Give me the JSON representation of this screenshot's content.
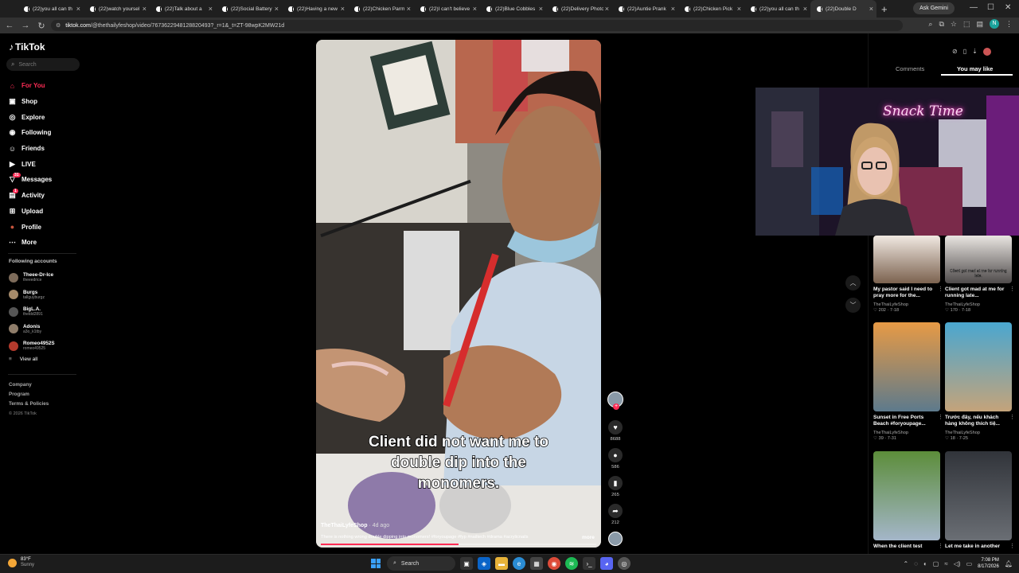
{
  "browser": {
    "tabs": [
      {
        "label": "(22)you all can th"
      },
      {
        "label": "(22)watch yoursel"
      },
      {
        "label": "(22)Talk about a"
      },
      {
        "label": "(22)Social Battery"
      },
      {
        "label": "(22)Having a new"
      },
      {
        "label": "(22)Chicken Parm"
      },
      {
        "label": "(22)I can't believe"
      },
      {
        "label": "(22)Blue Cobbles"
      },
      {
        "label": "(22)Delivery Photo"
      },
      {
        "label": "(22)Auntie Prank"
      },
      {
        "label": "(22)Chicken Pick"
      },
      {
        "label": "(22)you all can th"
      },
      {
        "label": "(22)Double D"
      }
    ],
    "ask_gemini": "Ask Gemini",
    "url_host": "tiktok.com",
    "url_path": "/@thethailyfeshop/video/7673622948128820493?_r=1&_t=ZT-98wpK2MW21d",
    "profile_initial": "N"
  },
  "sidebar": {
    "brand": "TikTok",
    "search_placeholder": "Search",
    "nav": [
      {
        "label": "For You",
        "icon": "home-icon",
        "active": true
      },
      {
        "label": "Shop",
        "icon": "shop-icon"
      },
      {
        "label": "Explore",
        "icon": "compass-icon"
      },
      {
        "label": "Following",
        "icon": "following-icon"
      },
      {
        "label": "Friends",
        "icon": "friends-icon"
      },
      {
        "label": "LIVE",
        "icon": "live-icon"
      },
      {
        "label": "Messages",
        "icon": "messages-icon",
        "badge": "31"
      },
      {
        "label": "Activity",
        "icon": "activity-icon",
        "badge": "1"
      },
      {
        "label": "Upload",
        "icon": "upload-icon"
      },
      {
        "label": "Profile",
        "icon": "profile-icon"
      },
      {
        "label": "More",
        "icon": "more-icon"
      }
    ],
    "following_title": "Following accounts",
    "accounts": [
      {
        "name": "Theee-Dr-Ice",
        "handle": "theeedrice",
        "color": "#7d6b5a"
      },
      {
        "name": "Burgs",
        "handle": "tallguyburgz",
        "color": "#a58a6a"
      },
      {
        "name": "BigL.A.",
        "handle": "theldd2891",
        "color": "#555"
      },
      {
        "name": "Adonis",
        "handle": "a3o_k1tby",
        "color": "#8f7d6a"
      },
      {
        "name": "Romeo4952S",
        "handle": "romeo49525",
        "color": "#b33a2c"
      }
    ],
    "view_all": "View all",
    "footer": [
      "Company",
      "Program",
      "Terms & Policies"
    ],
    "copyright": "© 2026 TikTok"
  },
  "video": {
    "caption": [
      "Client did not want me to",
      "double dip into the",
      "monomers."
    ],
    "author": "TheThaiLyfeShop",
    "ago": "· 4d ago",
    "description": "There is nothing wrong double dipping into monomers! #foryoupage #fyp #nailtech #drama #acrylicnails",
    "more": "more",
    "progress": 0.5
  },
  "actions": {
    "likes": "8688",
    "comments": "586",
    "saves": "265",
    "shares": "212"
  },
  "right_panel": {
    "tab_comments": "Comments",
    "tab_you_may_like": "You may like",
    "webcam_sign": "Snack Time",
    "cards": [
      {
        "title": "My pastor said I need to pray more for the...",
        "author": "TheThaiLyfeShop",
        "stats": "202 · 7-18",
        "overlay": "",
        "colors": [
          "#f1e9e2",
          "#7b624f"
        ]
      },
      {
        "title": "Client got mad at me for running late...",
        "author": "TheThaiLyfeShop",
        "stats": "170 · 7-18",
        "overlay": "Client got mad at me for running late.",
        "colors": [
          "#e9e5e1",
          "#4f4b4b"
        ]
      },
      {
        "title": "Sunset in Free Ports Beach #foryoupage...",
        "author": "TheThaiLyfeShop",
        "stats": "39 · 7-31",
        "overlay": "",
        "colors": [
          "#e79a45",
          "#5d7a8c"
        ]
      },
      {
        "title": "Trước đây, nếu khách hàng không thích tiệ...",
        "author": "TheThaiLyfeShop",
        "stats": "18 · 7-25",
        "overlay": "",
        "colors": [
          "#4aa7d0",
          "#c4a37a"
        ]
      },
      {
        "title": "When the client test",
        "author": "",
        "stats": "",
        "overlay": "",
        "colors": [
          "#5c8d3a",
          "#a4b6c9"
        ]
      },
      {
        "title": "Let me take in another",
        "author": "",
        "stats": "",
        "overlay": "",
        "colors": [
          "#31343a",
          "#6a6e74"
        ]
      }
    ]
  },
  "taskbar": {
    "temp": "83°F",
    "weather": "Sunny",
    "search": "Search",
    "time": "7:08 PM",
    "date": "8/17/2026"
  }
}
